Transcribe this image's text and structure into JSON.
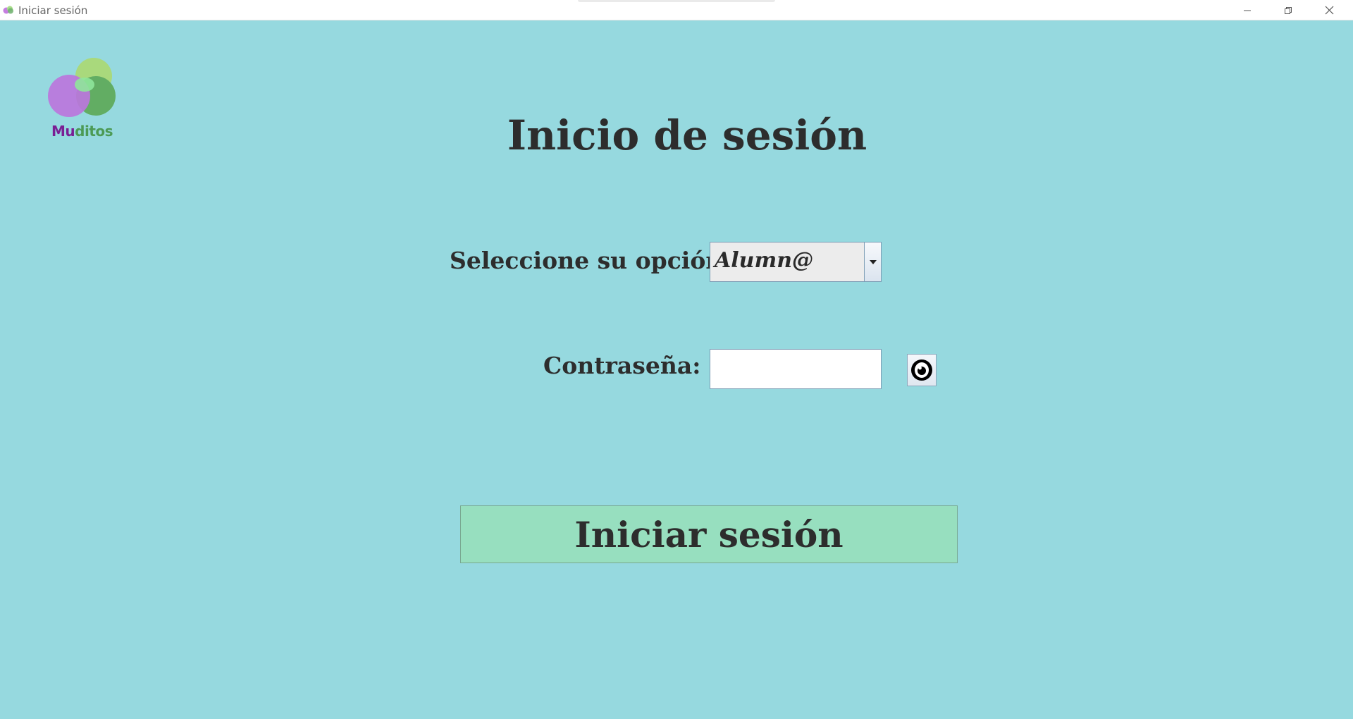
{
  "window": {
    "title": "Iniciar sesión"
  },
  "logo": {
    "text_part1": "Mu",
    "text_part2": "ditos"
  },
  "page": {
    "heading": "Inicio de sesión"
  },
  "form": {
    "option_label": "Seleccione su opción:",
    "option_value": "Alumn@",
    "password_label": "Contraseña:",
    "password_value": "",
    "submit_label": "Iniciar sesión"
  },
  "icons": {
    "app": "app-logo-icon",
    "minimize": "minimize-icon",
    "maximize": "restore-icon",
    "close": "close-icon",
    "dropdown": "chevron-down-icon",
    "show_password": "eye-icon"
  },
  "colors": {
    "background": "#96d9df",
    "button": "#97dfbf",
    "text": "#2d2d2d",
    "logo_purple": "#7a1f94",
    "logo_green": "#4c9a55"
  }
}
